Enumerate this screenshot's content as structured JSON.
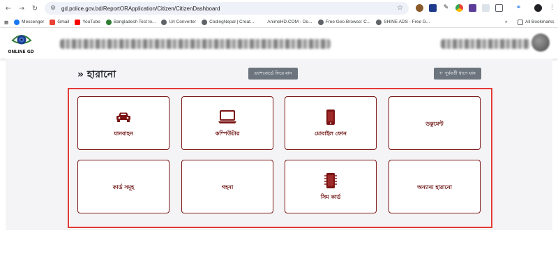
{
  "browser": {
    "url": "gd.police.gov.bd/ReportORApplication/Citizen/CitizenDashboard",
    "bookmarks": [
      "Messenger",
      "Gmail",
      "YouTube",
      "Bangladesh Test to...",
      "Url Converter",
      "CodingNepal | Creat...",
      "AnimeHD.COM - Do...",
      "Free Geo Browse: C...",
      "SHINE ADS - Free G..."
    ],
    "all_bookmarks_label": "All Bookmarks"
  },
  "header": {
    "logo_text": "ONLINE GD"
  },
  "page": {
    "title": "» হারানো",
    "dashboard_button": "ড্যাশবোর্ডে ফিরে যান",
    "back_button": "🡠 পূর্ববর্তী ধাপে যান"
  },
  "categories": [
    {
      "label": "যানবাহন",
      "icon": "car-icon"
    },
    {
      "label": "কম্পিউটার",
      "icon": "laptop-icon"
    },
    {
      "label": "মোবাইল ফোন",
      "icon": "mobile-phone-icon"
    },
    {
      "label": "ডকুমেন্ট",
      "icon": ""
    },
    {
      "label": "কার্ড সমূহ",
      "icon": ""
    },
    {
      "label": "গহনা",
      "icon": ""
    },
    {
      "label": "সিম কার্ড",
      "icon": "sim-card-icon"
    },
    {
      "label": "অন্যান্য হারানো",
      "icon": ""
    }
  ],
  "colors": {
    "card_border": "#7b1414",
    "label": "#6b0f0f",
    "highlight": "#e53935",
    "gray_button": "#6c757d"
  }
}
